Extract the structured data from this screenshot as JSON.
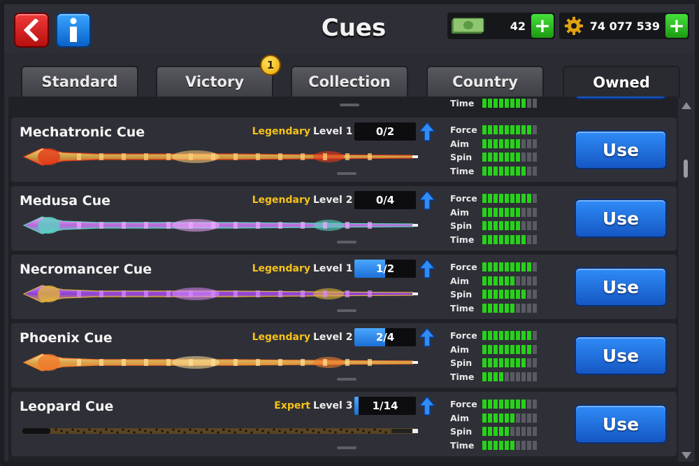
{
  "header": {
    "title": "Cues",
    "cash": "42",
    "coins": "74 077 539",
    "plus_label": "+"
  },
  "tabs": [
    {
      "label": "Standard"
    },
    {
      "label": "Victory",
      "badge": "1"
    },
    {
      "label": "Collection"
    },
    {
      "label": "Country"
    },
    {
      "label": "Owned",
      "active": true
    }
  ],
  "stat_labels": [
    "Force",
    "Aim",
    "Spin",
    "Time"
  ],
  "partial_row": {
    "stat_label": "Time"
  },
  "cues": [
    {
      "name": "Mechatronic Cue",
      "rarity": "Legendary",
      "level": "Level 1",
      "progress": "0/2",
      "progress_fraction": 0.0,
      "stats": [
        9,
        7,
        7,
        8
      ],
      "button": "Use"
    },
    {
      "name": "Medusa Cue",
      "rarity": "Legendary",
      "level": "Level 2",
      "progress": "0/4",
      "progress_fraction": 0.0,
      "stats": [
        9,
        7,
        7,
        8
      ],
      "button": "Use"
    },
    {
      "name": "Necromancer Cue",
      "rarity": "Legendary",
      "level": "Level 1",
      "progress": "1/2",
      "progress_fraction": 0.5,
      "stats": [
        9,
        6,
        8,
        6
      ],
      "button": "Use"
    },
    {
      "name": "Phoenix Cue",
      "rarity": "Legendary",
      "level": "Level 2",
      "progress": "2/4",
      "progress_fraction": 0.5,
      "stats": [
        9,
        9,
        8,
        4
      ],
      "button": "Use"
    },
    {
      "name": "Leopard Cue",
      "rarity": "Expert",
      "level": "Level 3",
      "progress": "1/14",
      "progress_fraction": 0.07,
      "stats": [
        8,
        6,
        5,
        6
      ],
      "button": "Use"
    }
  ],
  "colors": {
    "rarity": "#f6c21a",
    "stat_on": "#27d11a",
    "stat_off": "#5a5b62",
    "use_button": "#1f6fe0"
  },
  "icons": [
    "back-arrow-icon",
    "info-icon",
    "cash-icon",
    "coin-gear-icon",
    "plus-icon",
    "upgrade-arrow-icon"
  ]
}
